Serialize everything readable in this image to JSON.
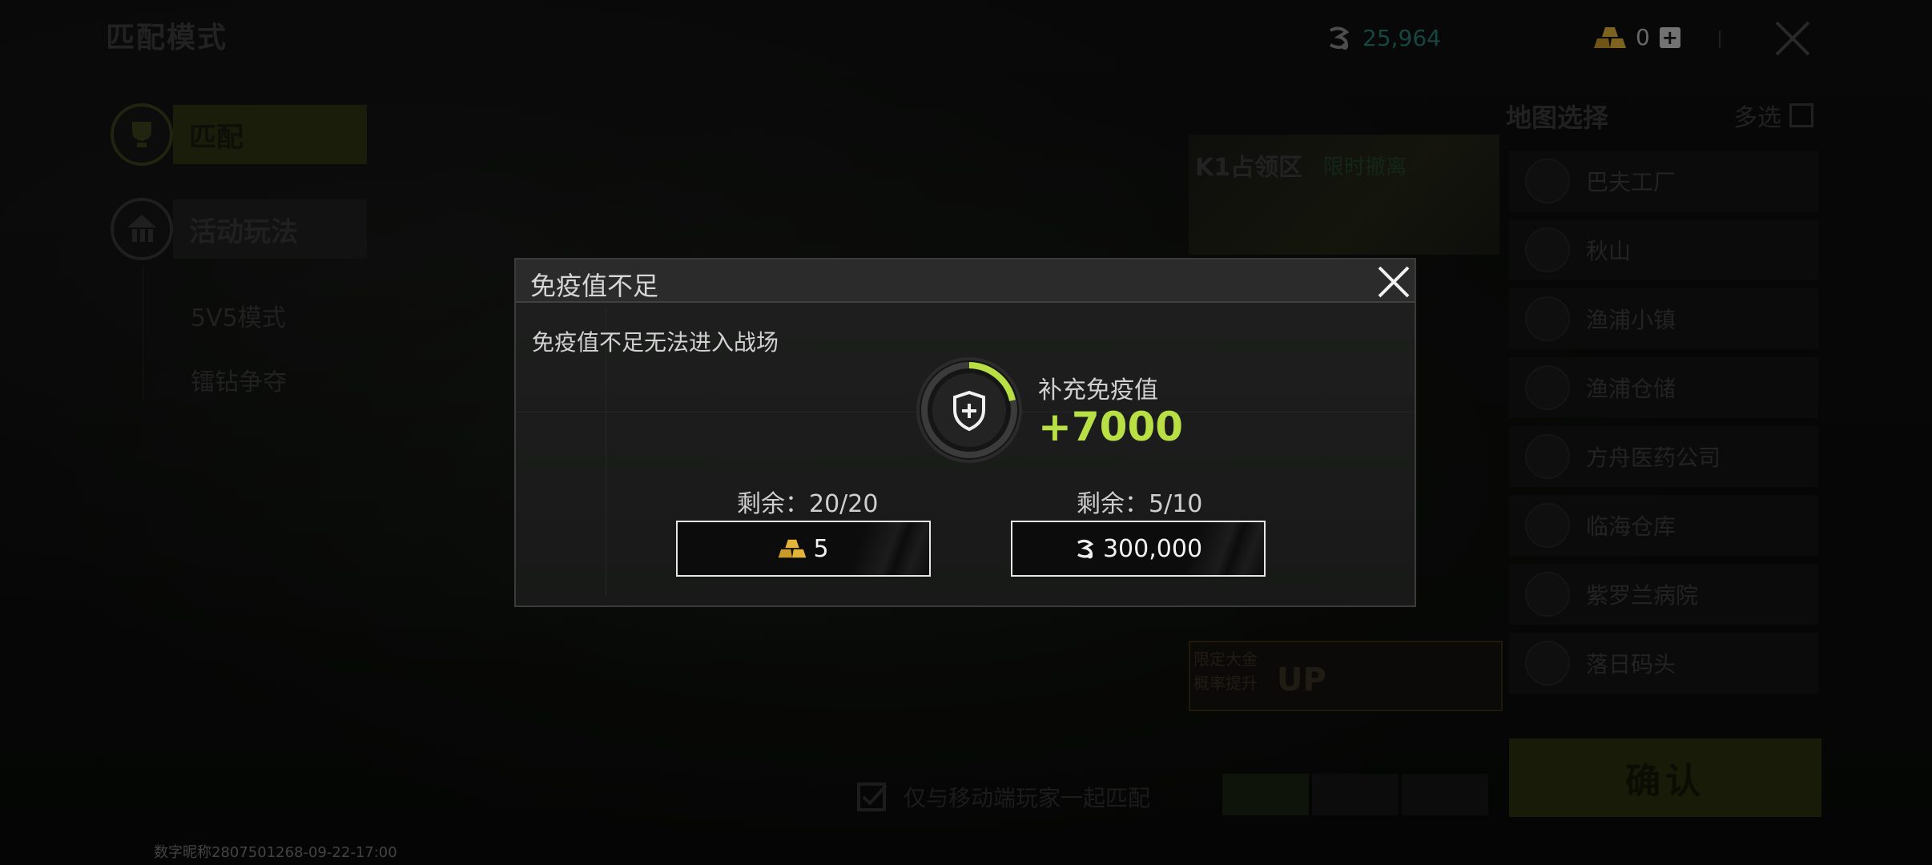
{
  "header": {
    "title": "匹配模式",
    "coins": "25,964",
    "gold": "0"
  },
  "left_menu": {
    "match": "匹配",
    "event": "活动玩法",
    "sub_items": [
      "5V5模式",
      "镭钻争夺"
    ]
  },
  "footer": {
    "id_text": "数字昵称2807501268-09-22-17:00"
  },
  "map_panel": {
    "title": "地图选择",
    "multi_select": "多选",
    "preview_title": "K1占领区",
    "preview_tag": "限时撤离",
    "promo_line1": "限定大金",
    "promo_line2": "概率提升",
    "promo_up": "UP",
    "maps": [
      "巴夫工厂",
      "秋山",
      "渔浦小镇",
      "渔浦仓储",
      "方舟医药公司",
      "临海仓库",
      "紫罗兰病院",
      "落日码头"
    ],
    "confirm": "确认",
    "mobile_only": "仅与移动端玩家一起匹配"
  },
  "dialog": {
    "title": "免疫值不足",
    "description": "免疫值不足无法进入战场",
    "refill_label": "补充免疫值",
    "refill_amount": "+7000",
    "left_remaining": "剩余：20/20",
    "left_price": "5",
    "right_remaining": "剩余：5/10",
    "right_price": "300,000"
  },
  "colors": {
    "accent_green": "#b8e045",
    "coin_teal": "#2b7f76",
    "gold": "#e2b43a"
  },
  "icons": {
    "coin": "coin-icon",
    "gold": "gold-bars-icon",
    "shield": "shield-plus-icon",
    "close": "close-icon"
  }
}
